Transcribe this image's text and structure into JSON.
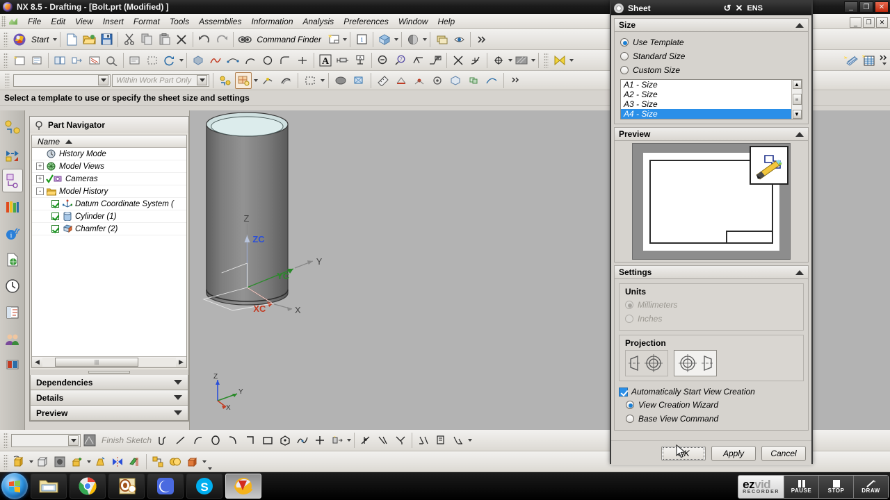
{
  "window": {
    "title": "NX 8.5 - Drafting - [Bolt.prt (Modified) ]",
    "logo_icon": "nx-logo-icon",
    "minimize_label": "_",
    "restore_label": "❐",
    "close_label": "✕"
  },
  "menu": {
    "app_icon": "nx-menu-icon",
    "items": [
      "File",
      "Edit",
      "View",
      "Insert",
      "Format",
      "Tools",
      "Assemblies",
      "Information",
      "Analysis",
      "Preferences",
      "Window",
      "Help"
    ]
  },
  "toolbar_main": {
    "start_label": "Start",
    "command_finder_label": "Command Finder",
    "icons": [
      "nx-start-icon",
      "new-file-icon",
      "open-folder-icon",
      "save-icon",
      "cut-scissors-icon",
      "copy-icon",
      "paste-icon",
      "delete-x-icon",
      "undo-icon",
      "redo-icon",
      "command-finder-icon",
      "new-sheet-icon",
      "info-icon"
    ]
  },
  "toolbar_second": {
    "icons": [
      "annotation-icon",
      "table-icon",
      "note-icon",
      "dimension-icon",
      "text-a-icon",
      "linear-dimension-icon",
      "datum-icon",
      "zoom-out-icon",
      "zoom-area-icon",
      "surface-finish-icon",
      "weld-symbol-icon",
      "intersect-icon",
      "centerline-icon",
      "target-icon",
      "hatch-icon",
      "balloon-icon"
    ]
  },
  "selection_bar": {
    "type_filter_value": "",
    "scope_value": "Within Work Part Only",
    "icons": [
      "snap-point-icon",
      "curve-rule-icon",
      "face-rule-icon",
      "stop-at-intersection-icon",
      "rectangle-select-icon",
      "shaded-icon",
      "wireframe-icon"
    ]
  },
  "prompt": {
    "text": "Select a template to use or specify the sheet size and settings"
  },
  "resource_bar": {
    "items": [
      {
        "name": "assembly-navigator-icon"
      },
      {
        "name": "constraint-navigator-icon"
      },
      {
        "name": "part-navigator-icon",
        "active": true
      },
      {
        "name": "reuse-library-icon"
      },
      {
        "name": "hd3d-tools-icon"
      },
      {
        "name": "web-browser-icon"
      },
      {
        "name": "history-icon"
      },
      {
        "name": "process-studio-icon"
      },
      {
        "name": "roles-icon"
      },
      {
        "name": "system-scene-icon"
      }
    ]
  },
  "part_navigator": {
    "title": "Part Navigator",
    "title_icon": "part-navigator-title-icon",
    "column_header": "Name",
    "sort_icon": "sort-ascending-icon",
    "tree": [
      {
        "label": "History Mode",
        "icon": "clock-icon",
        "expander": "",
        "checkbox": false,
        "indent": 1
      },
      {
        "label": "Model Views",
        "icon": "model-views-icon",
        "expander": "+",
        "checkbox": false,
        "indent": 0
      },
      {
        "label": "Cameras",
        "icon": "camera-icon",
        "expander": "+",
        "checkbox": false,
        "indent": 0
      },
      {
        "label": "Model History",
        "icon": "folder-icon",
        "expander": "-",
        "checkbox": false,
        "indent": 0
      },
      {
        "label": "Datum Coordinate System (",
        "icon": "datum-csys-icon",
        "expander": "",
        "checkbox": true,
        "indent": 1
      },
      {
        "label": "Cylinder (1)",
        "icon": "cylinder-icon",
        "expander": "",
        "checkbox": true,
        "indent": 1
      },
      {
        "label": "Chamfer (2)",
        "icon": "chamfer-icon",
        "expander": "",
        "checkbox": true,
        "indent": 1
      }
    ],
    "sections": [
      "Dependencies",
      "Details",
      "Preview"
    ]
  },
  "viewport": {
    "model_name": "bolt-cylinder-model",
    "wcs_labels": [
      "ZC",
      "YC",
      "XC"
    ],
    "axis_labels": [
      "Z",
      "Y",
      "X"
    ],
    "corner_triad_labels": [
      "Z",
      "Y",
      "X"
    ]
  },
  "sheet_dialog": {
    "title": "Sheet",
    "title_icon": "sheet-gear-icon",
    "reset_icon": "reset-icon",
    "close_icon": "close-x-icon",
    "ens_label": "ENS",
    "size_group": {
      "header": "Size",
      "collapse_icon": "chevron-up-icon",
      "options": [
        {
          "label": "Use Template",
          "selected": true
        },
        {
          "label": "Standard Size",
          "selected": false
        },
        {
          "label": "Custom Size",
          "selected": false
        }
      ],
      "templates": [
        {
          "label": "A1 - Size",
          "selected": false
        },
        {
          "label": "A2 - Size",
          "selected": false
        },
        {
          "label": "A3 - Size",
          "selected": false
        },
        {
          "label": "A4 - Size",
          "selected": true
        }
      ]
    },
    "preview_group": {
      "header": "Preview",
      "collapse_icon": "chevron-up-icon",
      "badge_icon": "drafting-pencil-icon"
    },
    "settings_group": {
      "header": "Settings",
      "collapse_icon": "chevron-up-icon",
      "units": {
        "title": "Units",
        "options": [
          {
            "label": "Millimeters",
            "selected": true,
            "disabled": true
          },
          {
            "label": "Inches",
            "selected": false,
            "disabled": true
          }
        ]
      },
      "projection": {
        "title": "Projection",
        "options": [
          {
            "name": "first-angle-projection-icon",
            "selected": false
          },
          {
            "name": "third-angle-projection-icon",
            "selected": true
          }
        ]
      },
      "auto_view": {
        "label": "Automatically Start View Creation",
        "checked": true,
        "options": [
          {
            "label": "View Creation Wizard",
            "selected": true
          },
          {
            "label": "Base View Command",
            "selected": false
          }
        ]
      }
    },
    "buttons": [
      {
        "label": "OK",
        "focused": true
      },
      {
        "label": "Apply",
        "focused": false
      },
      {
        "label": "Cancel",
        "focused": false
      }
    ]
  },
  "sketch_toolbar": {
    "finish_label": "Finish Sketch",
    "field_value": "",
    "icons": [
      "sketch-icon",
      "profile-icon",
      "line-icon",
      "arc-icon",
      "circle-icon",
      "fillet-icon",
      "chamfer-icon",
      "rectangle-icon",
      "polygon-icon",
      "spline-icon",
      "point-icon",
      "pattern-icon",
      "quick-trim-icon",
      "quick-extend-icon",
      "make-corner-icon",
      "constraint-icon",
      "dimension-icon",
      "auto-constraint-icon"
    ]
  },
  "feature_toolbar": {
    "icons": [
      "extrude-icon",
      "block-icon",
      "hole-icon",
      "boss-icon",
      "draft-icon",
      "mirror-icon",
      "datum-plane-icon",
      "pattern-feature-icon",
      "unite-icon",
      "shell-icon"
    ]
  },
  "taskbar": {
    "start_icon": "windows-start-orb-icon",
    "items": [
      {
        "name": "windows-explorer-icon",
        "active": false
      },
      {
        "name": "google-chrome-icon",
        "active": false
      },
      {
        "name": "outlook-icon",
        "active": false
      },
      {
        "name": "blue-app-icon",
        "active": false
      },
      {
        "name": "skype-icon",
        "active": false
      },
      {
        "name": "nx-app-icon",
        "active": true
      }
    ]
  },
  "ezvid": {
    "logo_top_a": "ez",
    "logo_top_b": "vid",
    "logo_bottom": "RECORDER",
    "buttons": [
      {
        "label": "PAUSE",
        "icon": "pause-icon"
      },
      {
        "label": "STOP",
        "icon": "stop-icon"
      },
      {
        "label": "DRAW",
        "icon": "draw-pen-icon"
      }
    ]
  },
  "colors": {
    "accent": "#2a8fe8",
    "viewport_bg": "#b3b3b3",
    "chrome": "#d6d3ce",
    "dark_title": "#1b1b1b"
  }
}
